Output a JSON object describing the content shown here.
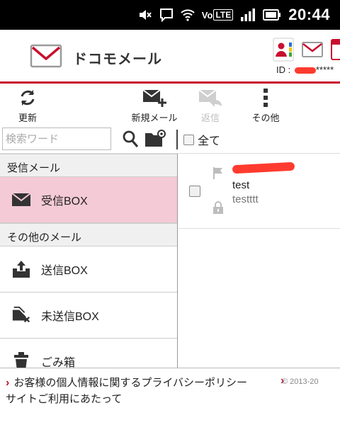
{
  "status_bar": {
    "time": "20:44",
    "volte": "LTE",
    "icons": [
      "mute-icon",
      "chat-icon",
      "wifi-icon",
      "signal-icon",
      "battery-icon"
    ]
  },
  "header": {
    "app_title": "ドコモメール",
    "id_prefix": "ID : ",
    "id_suffix": "*****",
    "icons": [
      "docomo-mail-logo",
      "contacts-icon",
      "mail-icon",
      "calendar-icon"
    ],
    "accent_color": "#c8102e"
  },
  "toolbar": {
    "refresh_label": "更新",
    "new_mail_label": "新規メール",
    "reply_label": "返信",
    "more_label": "その他"
  },
  "search": {
    "placeholder": "検索ワード",
    "value": "",
    "select_all_label": "全て"
  },
  "sidebar": {
    "section_inbox_header": "受信メール",
    "inbox_label": "受信BOX",
    "section_other_header": "その他のメール",
    "sent_label": "送信BOX",
    "unsent_label": "未送信BOX",
    "trash_label": "ごみ箱",
    "selected_color": "#f4cad6"
  },
  "mails": [
    {
      "subject": "test",
      "preview": "testttt"
    }
  ],
  "footer": {
    "privacy_link": "お客様の個人情報に関するプライバシーポリシー",
    "site_usage_link": "サイトご利用にあたって",
    "copyright": "© 2013-20"
  }
}
